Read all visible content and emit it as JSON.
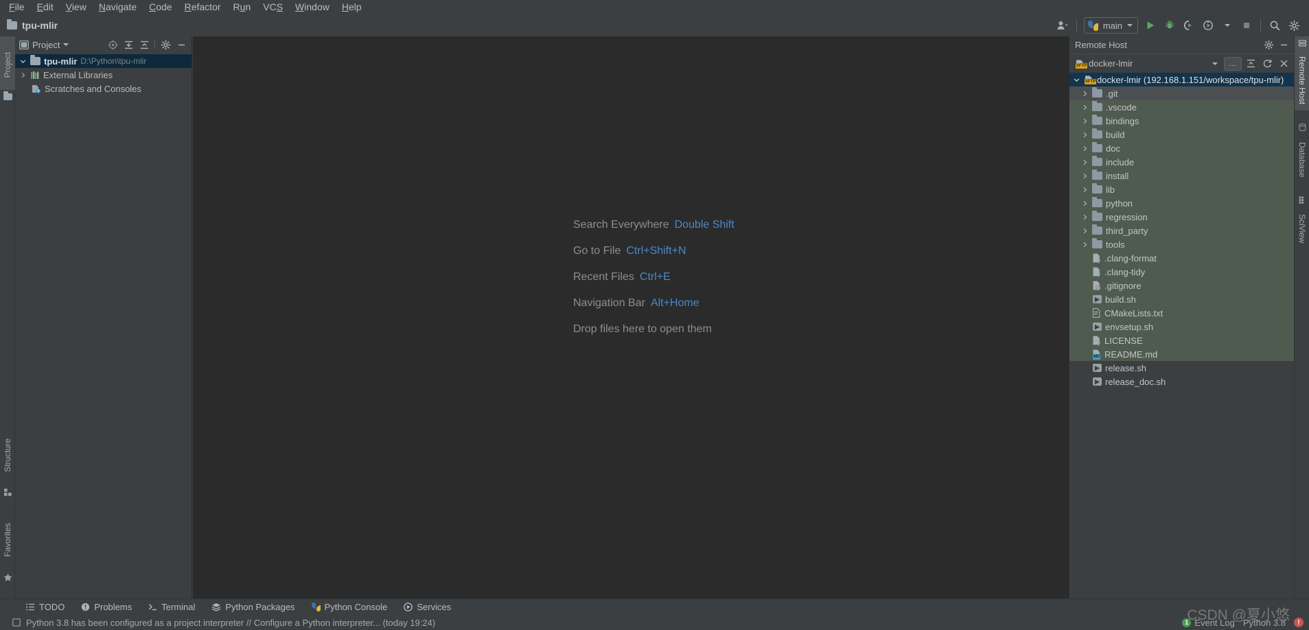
{
  "menubar": {
    "items": [
      {
        "label": "File",
        "mnemonic": "F"
      },
      {
        "label": "Edit",
        "mnemonic": "E"
      },
      {
        "label": "View",
        "mnemonic": "V"
      },
      {
        "label": "Navigate",
        "mnemonic": "N"
      },
      {
        "label": "Code",
        "mnemonic": "C"
      },
      {
        "label": "Refactor",
        "mnemonic": "R"
      },
      {
        "label": "Run",
        "mnemonic": "u"
      },
      {
        "label": "VCS",
        "mnemonic": "S"
      },
      {
        "label": "Window",
        "mnemonic": "W"
      },
      {
        "label": "Help",
        "mnemonic": "H"
      }
    ]
  },
  "toolbar": {
    "project_name": "tpu-mlir",
    "run_config": "main",
    "icons": {
      "user": "user-avatar-icon",
      "run": "run-icon",
      "debug": "debug-icon",
      "run_coverage": "run-with-coverage-icon",
      "profile": "profile-icon",
      "stop": "stop-icon",
      "search": "search-icon",
      "settings": "gear-icon"
    }
  },
  "left_strip": {
    "tabs": [
      {
        "label": "Project",
        "icon": "project-icon",
        "active": true
      },
      {
        "label": "Structure",
        "icon": "structure-icon",
        "active": false
      },
      {
        "label": "Favorites",
        "icon": "star-icon",
        "active": false
      }
    ]
  },
  "right_strip": {
    "tabs": [
      {
        "label": "Remote Host",
        "icon": "remote-host-icon",
        "active": true
      },
      {
        "label": "Database",
        "icon": "database-icon",
        "active": false
      },
      {
        "label": "SciView",
        "icon": "sciview-icon",
        "active": false
      }
    ]
  },
  "project_panel": {
    "title": "Project",
    "header_icons": [
      "select-opened-file-icon",
      "expand-all-icon",
      "collapse-all-icon",
      "gear-icon",
      "hide-icon"
    ],
    "tree": [
      {
        "label": "tpu-mlir",
        "path": "D:\\Python\\tpu-mlir",
        "icon": "folder-icon",
        "expanded": true,
        "selected": true,
        "indent": 0
      },
      {
        "label": "External Libraries",
        "icon": "libraries-icon",
        "expanded": false,
        "selected": false,
        "indent": 0
      },
      {
        "label": "Scratches and Consoles",
        "icon": "scratches-icon",
        "expanded": null,
        "selected": false,
        "indent": 0
      }
    ]
  },
  "editor": {
    "tips": [
      {
        "action": "Search Everywhere",
        "shortcut": "Double Shift"
      },
      {
        "action": "Go to File",
        "shortcut": "Ctrl+Shift+N"
      },
      {
        "action": "Recent Files",
        "shortcut": "Ctrl+E"
      },
      {
        "action": "Navigation Bar",
        "shortcut": "Alt+Home"
      },
      {
        "action": "Drop files here to open them",
        "shortcut": ""
      }
    ]
  },
  "remote_host": {
    "title": "Remote Host",
    "header_icons": [
      "gear-icon",
      "hide-icon"
    ],
    "connection": "docker-lmir",
    "toolbar_icons": [
      "chevron-down-icon",
      "more-options-icon",
      "collapse-all-icon",
      "refresh-icon",
      "close-icon"
    ],
    "tree": [
      {
        "label": "docker-lmir (192.168.1.151/workspace/tpu-mlir)",
        "type": "root",
        "icon": "sftp-host-icon",
        "expanded": true,
        "selected": true,
        "state": "selected"
      },
      {
        "label": ".git",
        "type": "folder",
        "icon": "folder-icon",
        "expanded": false,
        "state": "hover"
      },
      {
        "label": ".vscode",
        "type": "folder",
        "icon": "folder-icon",
        "expanded": false,
        "state": "normal"
      },
      {
        "label": "bindings",
        "type": "folder",
        "icon": "folder-icon",
        "expanded": false,
        "state": "normal"
      },
      {
        "label": "build",
        "type": "folder",
        "icon": "folder-icon",
        "expanded": false,
        "state": "normal"
      },
      {
        "label": "doc",
        "type": "folder",
        "icon": "folder-icon",
        "expanded": false,
        "state": "normal"
      },
      {
        "label": "include",
        "type": "folder",
        "icon": "folder-icon",
        "expanded": false,
        "state": "normal"
      },
      {
        "label": "install",
        "type": "folder",
        "icon": "folder-icon",
        "expanded": false,
        "state": "normal"
      },
      {
        "label": "lib",
        "type": "folder",
        "icon": "folder-icon",
        "expanded": false,
        "state": "normal"
      },
      {
        "label": "python",
        "type": "folder",
        "icon": "folder-icon",
        "expanded": false,
        "state": "normal"
      },
      {
        "label": "regression",
        "type": "folder",
        "icon": "folder-icon",
        "expanded": false,
        "state": "normal"
      },
      {
        "label": "third_party",
        "type": "folder",
        "icon": "folder-icon",
        "expanded": false,
        "state": "normal"
      },
      {
        "label": "tools",
        "type": "folder",
        "icon": "folder-icon",
        "expanded": false,
        "state": "normal"
      },
      {
        "label": ".clang-format",
        "type": "file",
        "icon": "unknown-file-icon",
        "state": "normal"
      },
      {
        "label": ".clang-tidy",
        "type": "file",
        "icon": "unknown-file-icon",
        "state": "normal"
      },
      {
        "label": ".gitignore",
        "type": "file",
        "icon": "ignored-file-icon",
        "state": "normal"
      },
      {
        "label": "build.sh",
        "type": "file",
        "icon": "shell-script-icon",
        "state": "normal"
      },
      {
        "label": "CMakeLists.txt",
        "type": "file",
        "icon": "text-file-icon",
        "state": "normal"
      },
      {
        "label": "envsetup.sh",
        "type": "file",
        "icon": "shell-script-icon",
        "state": "normal"
      },
      {
        "label": "LICENSE",
        "type": "file",
        "icon": "unknown-file-icon",
        "state": "normal"
      },
      {
        "label": "README.md",
        "type": "file",
        "icon": "markdown-file-icon",
        "state": "normal"
      },
      {
        "label": "release.sh",
        "type": "file",
        "icon": "shell-script-icon",
        "state": "normal"
      },
      {
        "label": "release_doc.sh",
        "type": "file",
        "icon": "shell-script-icon",
        "state": "normal"
      }
    ]
  },
  "bottom_bar": {
    "buttons": [
      {
        "label": "TODO",
        "icon": "todo-icon"
      },
      {
        "label": "Problems",
        "icon": "problems-icon"
      },
      {
        "label": "Terminal",
        "icon": "terminal-icon"
      },
      {
        "label": "Python Packages",
        "icon": "python-packages-icon"
      },
      {
        "label": "Python Console",
        "icon": "python-console-icon"
      },
      {
        "label": "Services",
        "icon": "services-icon"
      }
    ]
  },
  "status_bar": {
    "message": "Python 3.8 has been configured as a project interpreter // Configure a Python interpreter... (today 19:24)",
    "message_icon": "balloon-icon",
    "event_log": "Event Log",
    "event_count": "1",
    "interpreter": "Python 3.8",
    "error_icon": "error-icon"
  },
  "watermark": "CSDN @夏小悠",
  "colors": {
    "background": "#3c3f41",
    "editor_background": "#2b2b2b",
    "remote_tree_background": "#4f5b4f",
    "selection_blue": "#14344c",
    "accent_link": "#4a88c7",
    "run_green": "#499c54",
    "error_red": "#c75450"
  }
}
